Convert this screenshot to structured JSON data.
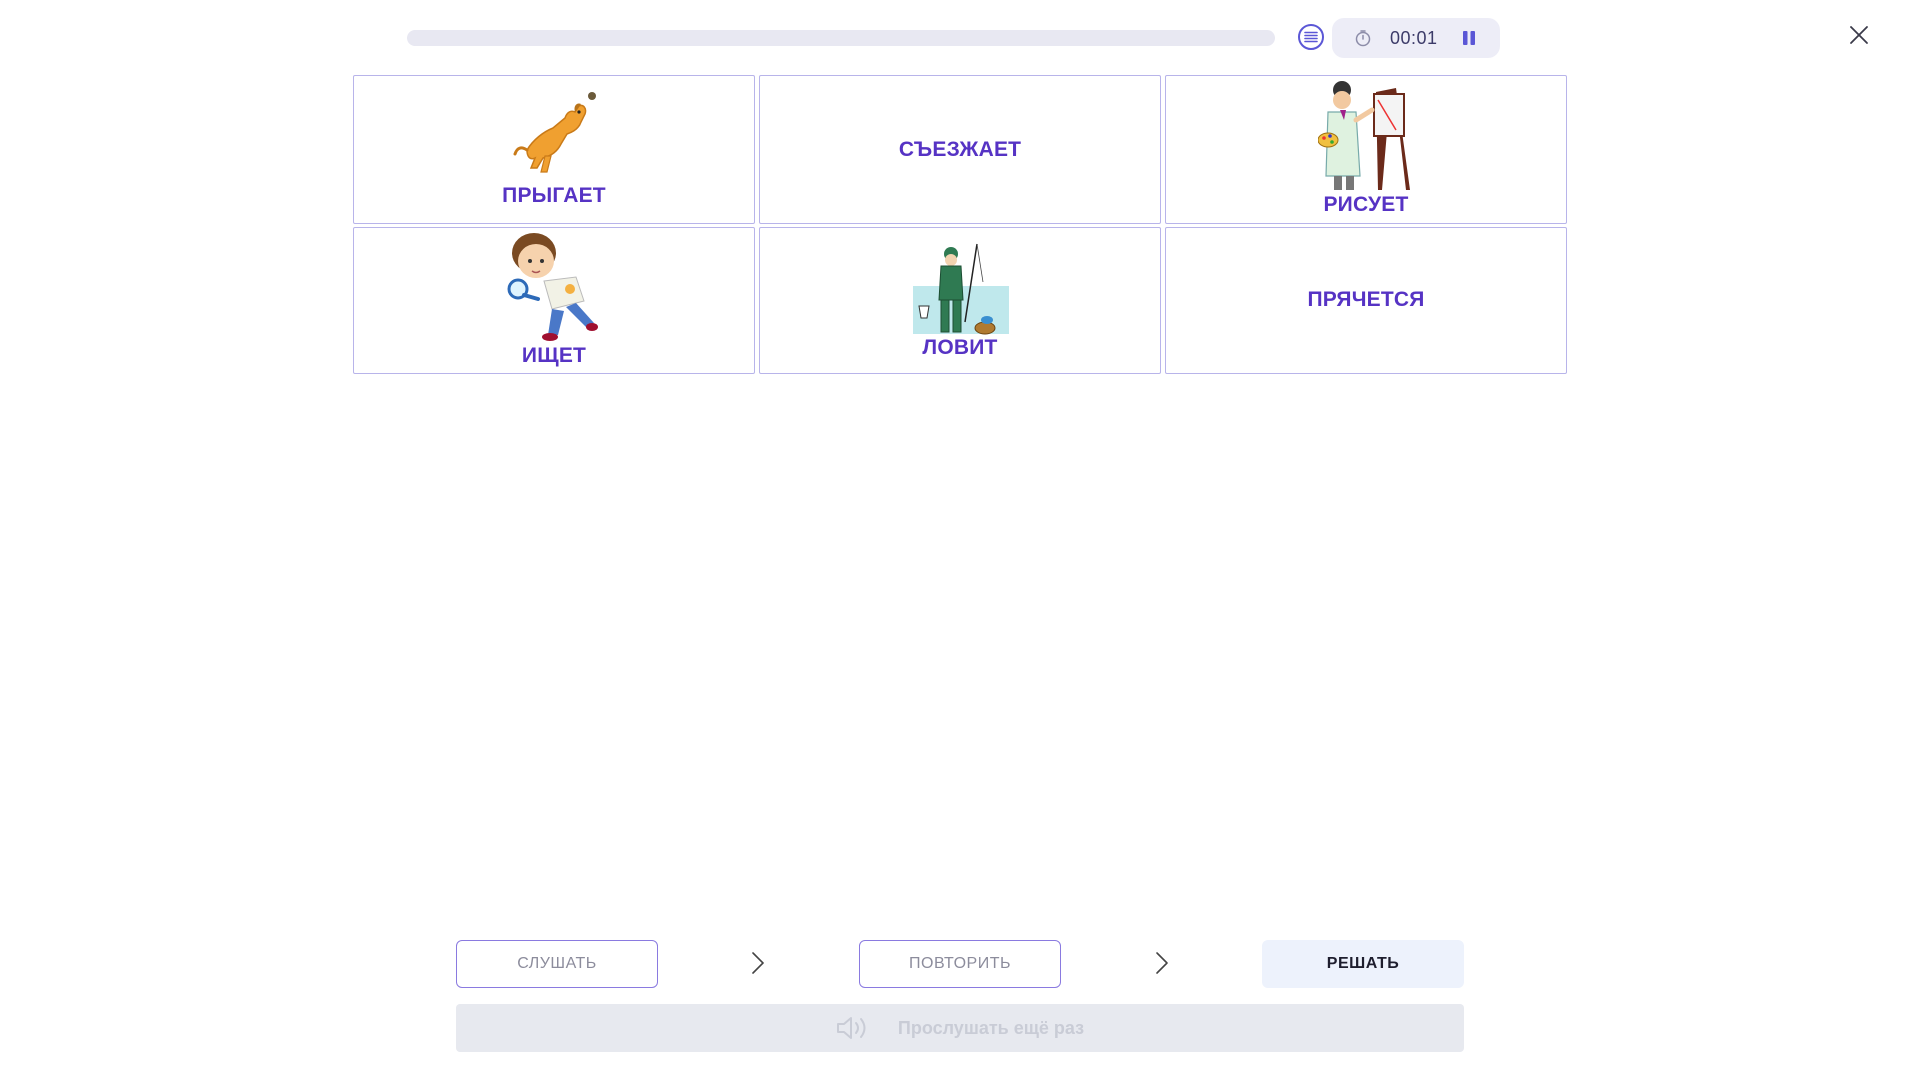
{
  "progress": {
    "fraction": 0.0
  },
  "timer": {
    "time": "00:01"
  },
  "icons": {
    "menu": "list-icon",
    "timer": "stopwatch-icon",
    "pause": "pause-icon",
    "close": "close-icon",
    "next": "chevron-right-icon",
    "sound": "speaker-icon"
  },
  "cards": [
    {
      "label": "ПРЫГАЕТ",
      "image": "jumping-dog"
    },
    {
      "label": "СЪЕЗЖАЕТ",
      "image": ""
    },
    {
      "label": "РИСУЕТ",
      "image": "painter-at-easel"
    },
    {
      "label": "ИЩЕТ",
      "image": "boy-with-magnifier"
    },
    {
      "label": "ЛОВИТ",
      "image": "fisherman"
    },
    {
      "label": "ПРЯЧЕТСЯ",
      "image": ""
    }
  ],
  "steps": [
    {
      "label": "СЛУШАТЬ",
      "state": "done"
    },
    {
      "label": "ПОВТОРИТЬ",
      "state": "done"
    },
    {
      "label": "РЕШАТЬ",
      "state": "active"
    }
  ],
  "listen_again": {
    "label": "Прослушать ещё раз",
    "enabled": false
  },
  "colors": {
    "accent": "#5633c4",
    "card_border": "#b8b4ea",
    "progress_track": "#e8e8f2",
    "timer_bg": "#ededf7",
    "active_step_bg": "#edf2fc",
    "disabled_bg": "#e7e9ef"
  }
}
